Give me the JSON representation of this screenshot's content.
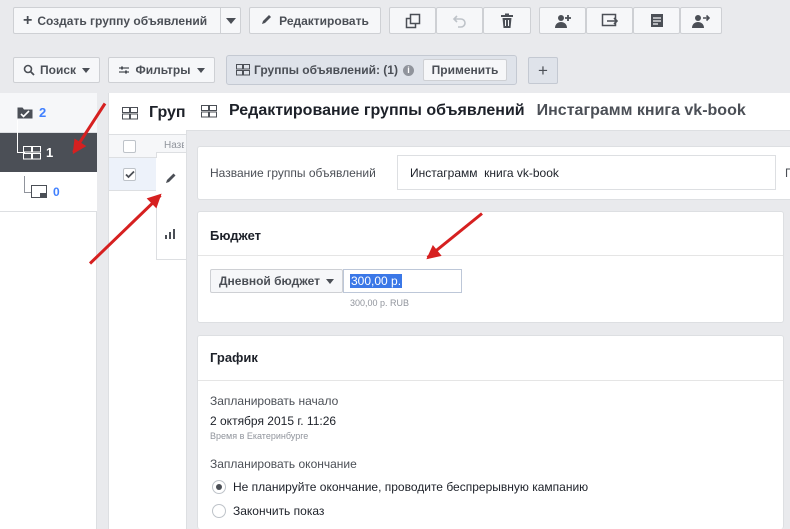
{
  "toolbar": {
    "create_label": "Создать группу объявлений",
    "edit_label": "Редактировать"
  },
  "filterbar": {
    "search_label": "Поиск",
    "filters_label": "Фильтры",
    "chip_label": "Группы объявлений: (1)",
    "apply_label": "Применить",
    "add_symbol": "+"
  },
  "tree": {
    "campaign_count": "2",
    "adset_count": "1",
    "ad_count": "0"
  },
  "table": {
    "title_partial": "Груп",
    "col_name_partial": "Назв"
  },
  "panel": {
    "title": "Редактирование группы объявлений",
    "subtitle": "Инстаграмм книга vk-book",
    "name_label": "Название группы объявлений",
    "name_value": "Инстаграмм  книга vk-book",
    "name_side_partial": "П",
    "budget_title": "Бюджет",
    "budget_type": "Дневной бюджет",
    "budget_value": "300,00 р.",
    "budget_note": "300,00 р. RUB",
    "schedule_title": "График",
    "start_label": "Запланировать начало",
    "start_value": "2 октября 2015 г. 11:26",
    "timezone_note": "Время в Екатеринбурге",
    "end_label": "Запланировать окончание",
    "end_option_1": "Не планируйте окончание, проводите беспрерывную кампанию",
    "end_option_2": "Закончить показ"
  },
  "colors": {
    "accent": "#4080ff",
    "annotation": "#d62020",
    "selected_row": "#4b4f56"
  }
}
